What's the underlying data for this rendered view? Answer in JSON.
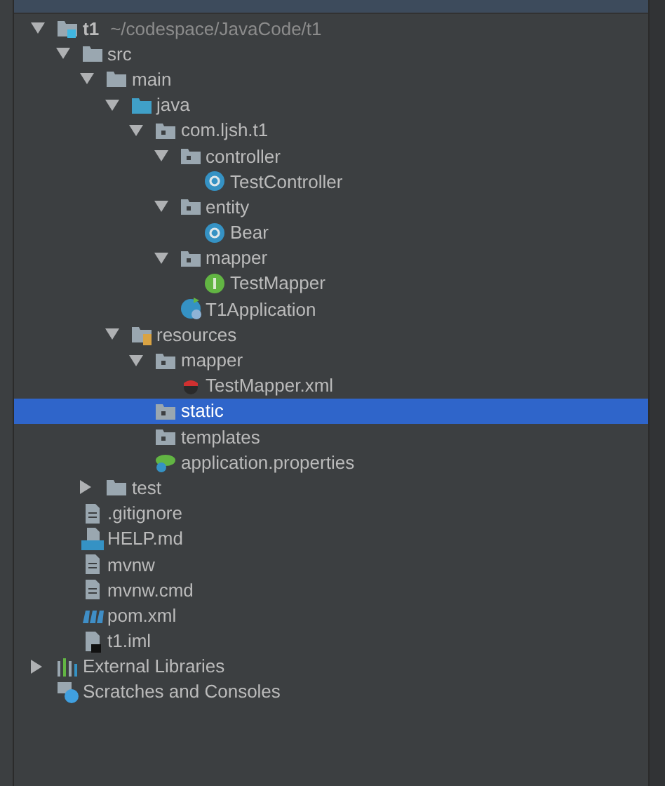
{
  "project_tree": [
    {
      "label": "t1",
      "path": "~/codespace/JavaCode/t1",
      "kind": "project",
      "expanded": true,
      "selected": false,
      "children": [
        {
          "label": "src",
          "kind": "folder",
          "expanded": true,
          "selected": false,
          "children": [
            {
              "label": "main",
              "kind": "folder",
              "expanded": true,
              "selected": false,
              "children": [
                {
                  "label": "java",
                  "kind": "source-folder",
                  "expanded": true,
                  "selected": false,
                  "children": [
                    {
                      "label": "com.ljsh.t1",
                      "kind": "package",
                      "expanded": true,
                      "selected": false,
                      "children": [
                        {
                          "label": "controller",
                          "kind": "package",
                          "expanded": true,
                          "selected": false,
                          "children": [
                            {
                              "label": "TestController",
                              "kind": "class",
                              "selected": false
                            }
                          ]
                        },
                        {
                          "label": "entity",
                          "kind": "package",
                          "expanded": true,
                          "selected": false,
                          "children": [
                            {
                              "label": "Bear",
                              "kind": "class",
                              "selected": false
                            }
                          ]
                        },
                        {
                          "label": "mapper",
                          "kind": "package",
                          "expanded": true,
                          "selected": false,
                          "children": [
                            {
                              "label": "TestMapper",
                              "kind": "interface",
                              "selected": false
                            }
                          ]
                        },
                        {
                          "label": "T1Application",
                          "kind": "spring-app",
                          "selected": false
                        }
                      ]
                    }
                  ]
                },
                {
                  "label": "resources",
                  "kind": "resources",
                  "expanded": true,
                  "selected": false,
                  "children": [
                    {
                      "label": "mapper",
                      "kind": "package",
                      "expanded": true,
                      "selected": false,
                      "children": [
                        {
                          "label": "TestMapper.xml",
                          "kind": "xml",
                          "selected": false
                        }
                      ]
                    },
                    {
                      "label": "static",
                      "kind": "package",
                      "selected": true
                    },
                    {
                      "label": "templates",
                      "kind": "package",
                      "selected": false
                    },
                    {
                      "label": "application.properties",
                      "kind": "properties",
                      "selected": false
                    }
                  ]
                }
              ]
            },
            {
              "label": "test",
              "kind": "folder",
              "expanded": false,
              "selected": false
            }
          ]
        },
        {
          "label": ".gitignore",
          "kind": "file",
          "selected": false
        },
        {
          "label": "HELP.md",
          "kind": "markdown",
          "selected": false
        },
        {
          "label": "mvnw",
          "kind": "file",
          "selected": false
        },
        {
          "label": "mvnw.cmd",
          "kind": "file",
          "selected": false
        },
        {
          "label": "pom.xml",
          "kind": "maven",
          "selected": false
        },
        {
          "label": "t1.iml",
          "kind": "iml",
          "selected": false
        }
      ]
    },
    {
      "label": "External Libraries",
      "kind": "libraries",
      "expanded": false,
      "selected": false
    },
    {
      "label": "Scratches and Consoles",
      "kind": "scratches",
      "selected": false
    }
  ]
}
